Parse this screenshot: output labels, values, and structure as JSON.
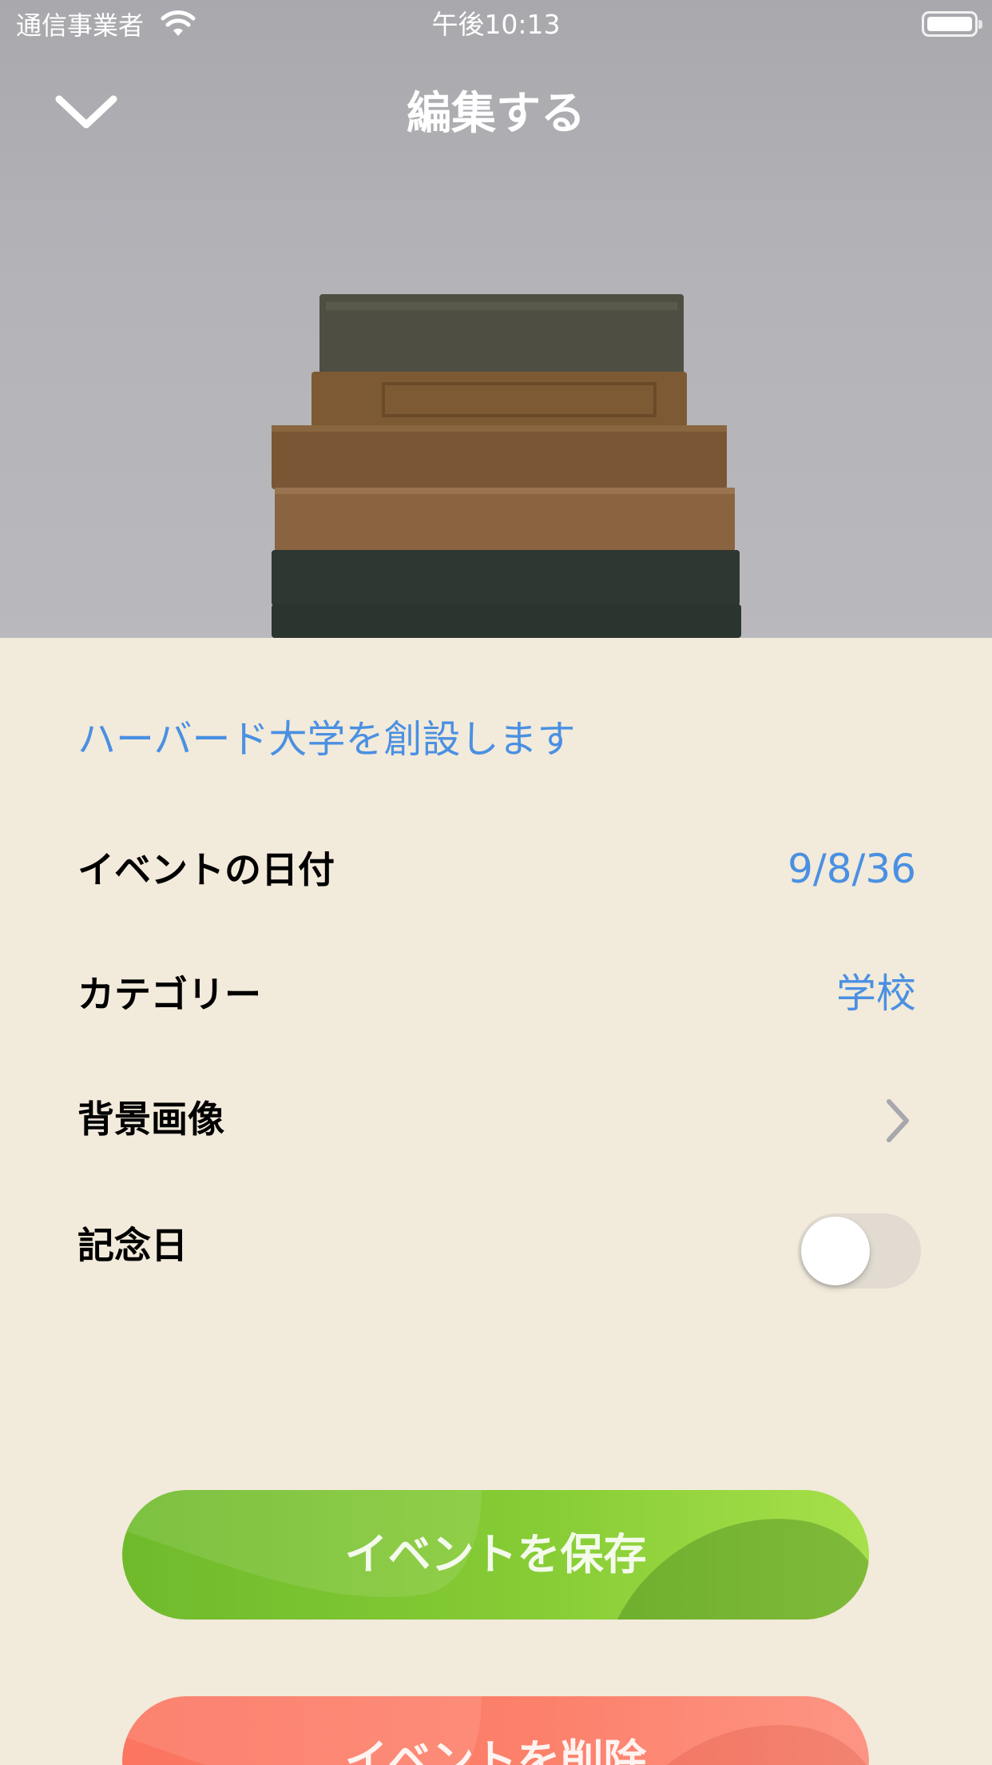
{
  "status_bar": {
    "carrier": "通信事業者",
    "time": "午後10:13"
  },
  "nav": {
    "title": "編集する"
  },
  "event": {
    "title": "ハーバード大学を創設します"
  },
  "form": {
    "date_label": "イベントの日付",
    "date_value": "9/8/36",
    "category_label": "カテゴリー",
    "category_value": "学校",
    "background_label": "背景画像",
    "anniversary_label": "記念日",
    "anniversary_on": false
  },
  "actions": {
    "save_label": "イベントを保存",
    "delete_label": "イベントを削除"
  },
  "colors": {
    "accent": "#4a90e2",
    "background": "#f2eadb",
    "save": "#7cc232",
    "delete": "#fc806a"
  }
}
